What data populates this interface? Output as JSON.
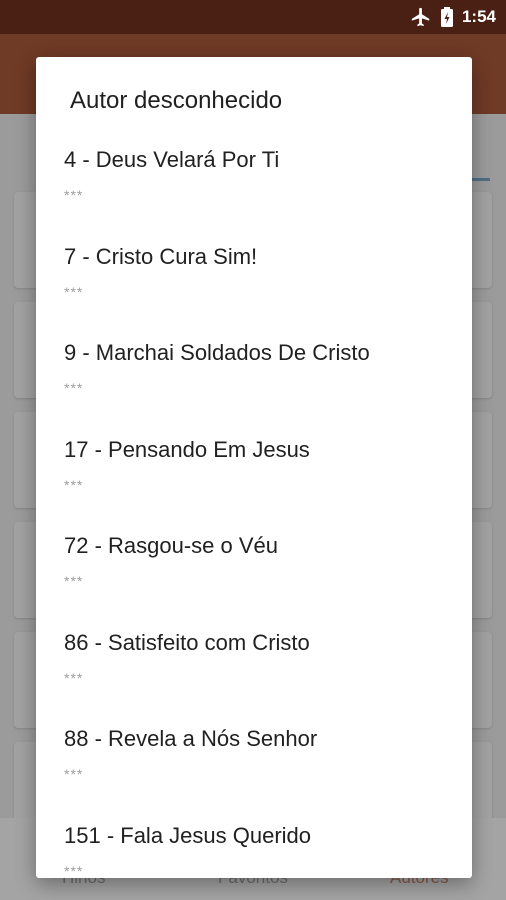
{
  "status_bar": {
    "time": "1:54",
    "icons": [
      "airplane-icon",
      "battery-charging-icon"
    ]
  },
  "bottom_nav": {
    "tabs": [
      {
        "label": "Hinos"
      },
      {
        "label": "Favoritos"
      },
      {
        "label": "Autores"
      }
    ]
  },
  "dialog": {
    "title": "Autor desconhecido",
    "items": [
      {
        "title": "4 - Deus Velará Por Ti",
        "subtitle": "***"
      },
      {
        "title": "7 - Cristo Cura Sim!",
        "subtitle": "***"
      },
      {
        "title": "9 - Marchai Soldados De Cristo",
        "subtitle": "***"
      },
      {
        "title": "17 - Pensando Em Jesus",
        "subtitle": "***"
      },
      {
        "title": "72 - Rasgou-se o Véu",
        "subtitle": "***"
      },
      {
        "title": "86 - Satisfeito com Cristo",
        "subtitle": "***"
      },
      {
        "title": "88 - Revela a Nós Senhor",
        "subtitle": "***"
      },
      {
        "title": "151 - Fala Jesus Querido",
        "subtitle": "***"
      }
    ]
  },
  "colors": {
    "status_bar": "#4a2014",
    "app_bar_dimmed": "#6f3a26",
    "scrim": "#9b9b9b",
    "dialog_bg": "#ffffff"
  }
}
